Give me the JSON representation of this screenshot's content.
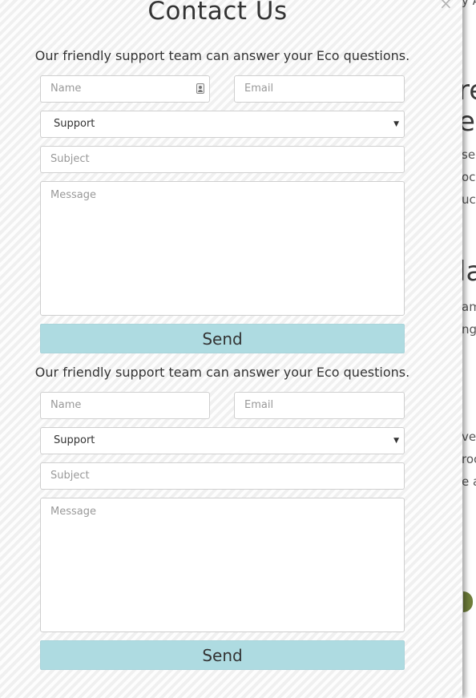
{
  "modal": {
    "title": "Contact Us",
    "close_symbol": "×"
  },
  "forms": [
    {
      "intro": "Our friendly support team can answer your Eco questions.",
      "name_placeholder": "Name",
      "email_placeholder": "Email",
      "department_value": "Support",
      "subject_placeholder": "Subject",
      "message_placeholder": "Message",
      "send_label": "Send"
    },
    {
      "intro": "Our friendly support team can answer your Eco questions.",
      "name_placeholder": "Name",
      "email_placeholder": "Email",
      "department_value": "Support",
      "subject_placeholder": "Subject",
      "message_placeholder": "Message",
      "send_label": "Send"
    }
  ],
  "background_page": {
    "fragments": [
      "y A",
      "re",
      "e",
      "sel",
      "oci",
      "uc",
      "la",
      "am",
      "ng",
      "ve",
      "roc",
      "e a"
    ]
  },
  "colors": {
    "send_button": "#aedbe1",
    "panel_background": "#f6f6f6"
  },
  "icons": {
    "name_field_icon": "contact-card-icon",
    "select_caret": "caret-down-icon",
    "close": "close-icon"
  }
}
